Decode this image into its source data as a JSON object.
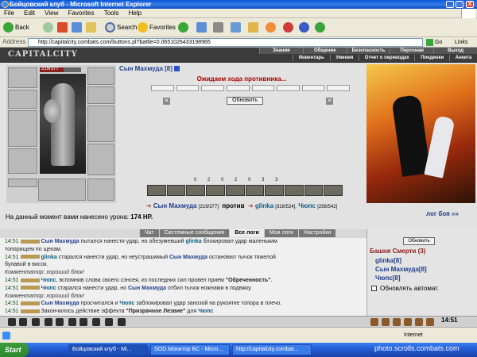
{
  "window": {
    "title": "Бойцовский клуб - Microsoft Internet Explorer",
    "controls": [
      "_",
      "□",
      "X"
    ]
  },
  "menu": [
    "File",
    "Edit",
    "View",
    "Favorites",
    "Tools",
    "Help"
  ],
  "toolbar": {
    "back": "Back",
    "search": "Search",
    "favorites": "Favorites"
  },
  "address": {
    "label": "Address",
    "url": "http://capitalcity.combats.com/buttons.pl?battle=0.0651026433198965",
    "go": "Go",
    "links": "Links"
  },
  "game": {
    "logo": "CAPITALCITY",
    "topnav": [
      "Знания",
      "Общение",
      "Безопасность",
      "Персонаж",
      "Выход"
    ],
    "subnav": [
      "Инвентарь",
      "Умения",
      "Отчет о переводах",
      "Поединки",
      "Анкета"
    ],
    "player": {
      "name": "Сын Махмуда [8]",
      "hp_text": "219/377",
      "hp_fraction": 0.58
    },
    "waiting": "Ожидаем хода противника...",
    "refresh": "Обновить",
    "mod_counts": [
      "0",
      "2",
      "0",
      "2",
      "0",
      "3",
      "3"
    ],
    "versus": {
      "left": "Сын Махмуда",
      "left_hp": "[219/377]",
      "vs": "против",
      "right1": "glinka",
      "right1_hp": "[316/524],",
      "right2": "Чюпс",
      "right2_hp": "[258/542]"
    },
    "damage_label": "На данный момент вами нанесено урона:",
    "damage_value": "174 HP.",
    "log_link": "лог боя »»"
  },
  "tabs": [
    "Чат",
    "Системные сообщения",
    "Все логи",
    "Мои логи",
    "Настройки"
  ],
  "log": [
    {
      "time": "14:51",
      "segs": [
        {
          "c": "p1",
          "t": "Сын Махмуда"
        },
        {
          "c": "",
          "t": " пытался нанести удар, но обезумевший "
        },
        {
          "c": "p2",
          "t": "glinka"
        },
        {
          "c": "",
          "t": " блокировал удар маленьким"
        }
      ]
    },
    {
      "time": "",
      "segs": [
        {
          "c": "",
          "t": "топорищем по щекам."
        }
      ]
    },
    {
      "time": "14:51",
      "segs": [
        {
          "c": "p2",
          "t": "glinka"
        },
        {
          "c": "",
          "t": " старался нанести удар, но неустрашимый "
        },
        {
          "c": "p1",
          "t": "Сын Махмуда"
        },
        {
          "c": "",
          "t": " остановил тычок тяжелой"
        }
      ]
    },
    {
      "time": "",
      "segs": [
        {
          "c": "",
          "t": "булавой в висок."
        }
      ]
    },
    {
      "time": "",
      "segs": [
        {
          "c": "comment",
          "t": "Комментатор: хороший блок!"
        }
      ]
    },
    {
      "time": "14:51",
      "segs": [
        {
          "c": "p2",
          "t": "Чюпс"
        },
        {
          "c": "",
          "t": ", вспомнив слова своего сэнсея, из последних сил провел прием "
        },
        {
          "c": "em",
          "t": "\"Обреченность\""
        },
        {
          "c": "",
          "t": "."
        }
      ]
    },
    {
      "time": "14:51",
      "segs": [
        {
          "c": "p2",
          "t": "Чюпс"
        },
        {
          "c": "",
          "t": " старался нанести удар, но "
        },
        {
          "c": "p1",
          "t": "Сын Махмуда"
        },
        {
          "c": "",
          "t": " отбил тычок ножнами в подвжку."
        }
      ]
    },
    {
      "time": "",
      "segs": [
        {
          "c": "comment",
          "t": "Комментатор: хороший блок!"
        }
      ]
    },
    {
      "time": "14:51",
      "segs": [
        {
          "c": "p1",
          "t": "Сын Махмуда"
        },
        {
          "c": "",
          "t": " просчитался и "
        },
        {
          "c": "p2",
          "t": "Чюпс"
        },
        {
          "c": "",
          "t": " заблокировал удар занозой на рукоятке топора в плечо."
        }
      ]
    },
    {
      "time": "14:51",
      "segs": [
        {
          "c": "",
          "t": "Закончилось действие эффекта "
        },
        {
          "c": "em",
          "t": "\"Призрачное Лезвие\""
        },
        {
          "c": "",
          "t": " для "
        },
        {
          "c": "p2",
          "t": "Чюпс"
        }
      ]
    }
  ],
  "sidepanel": {
    "refresh": "Обновить",
    "title": "Башня Смерти (3)",
    "players": [
      "glinka[8]",
      "Сын Махмуда[8]",
      "Чюпс[8]"
    ],
    "auto_refresh": "Обновлять автомат."
  },
  "clock": "14:51",
  "status": {
    "zone": "Internet"
  },
  "taskbar": {
    "start": "Start",
    "tasks": [
      "Бойцовский клуб - Mi...",
      "SOD Монитор БС - Micro...",
      "http://capitalcity.combat..."
    ]
  },
  "watermark": "photo.scrolls.combats.com",
  "colors": {
    "xp_blue": "#245edb",
    "hp_red": "#8b2020",
    "player_blue": "#223d8a",
    "waiting_red": "#b10000"
  }
}
